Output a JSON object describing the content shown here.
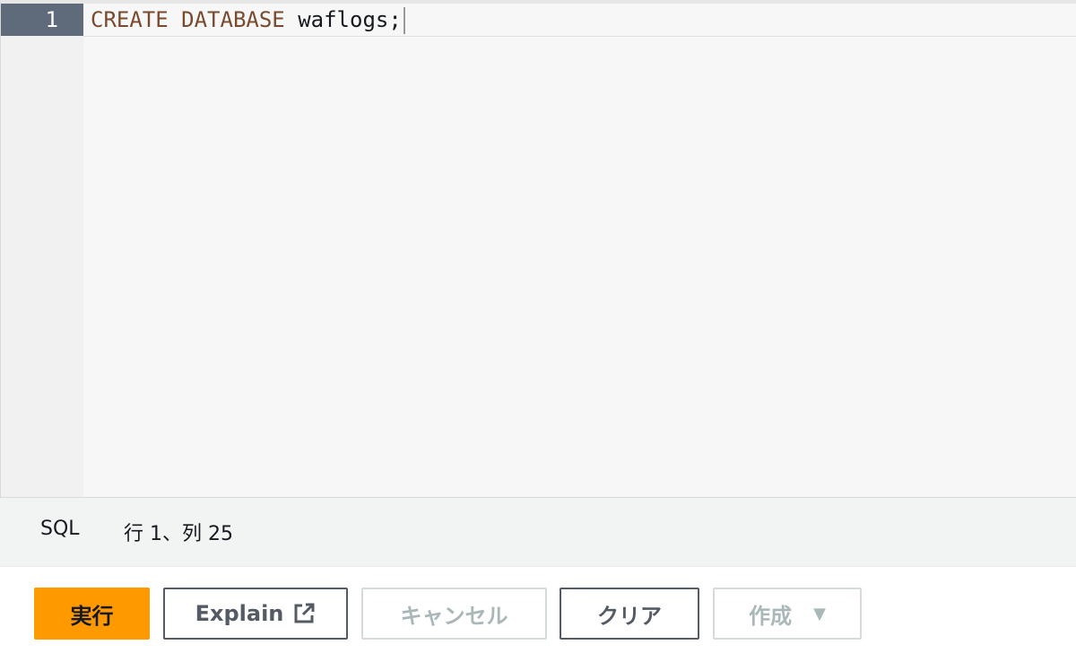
{
  "editor": {
    "line_number": "1",
    "code": {
      "keyword": "CREATE DATABASE",
      "identifier": "waflogs;"
    }
  },
  "status": {
    "mode": "SQL",
    "position": "行 1、列 25"
  },
  "toolbar": {
    "run_label": "実行",
    "explain_label": "Explain",
    "cancel_label": "キャンセル",
    "clear_label": "クリア",
    "create_label": "作成"
  },
  "icons": {
    "explain": "external-link-icon",
    "create": "caret-down-icon"
  },
  "colors": {
    "primary_button": "#ff9900",
    "keyword": "#7a4a2e",
    "gutter_active": "#5f6b7a"
  }
}
